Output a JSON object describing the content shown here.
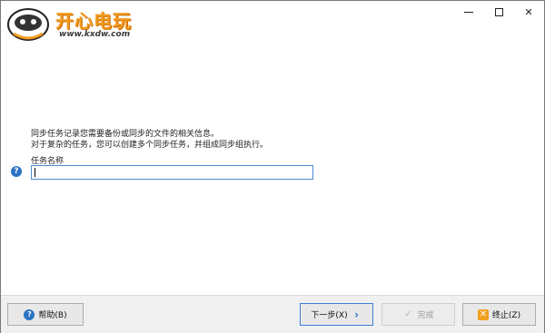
{
  "watermark": {
    "title": "开心电玩",
    "url": "www.kxdw.com"
  },
  "window_controls": {
    "minimize": "—",
    "maximize": "□",
    "close": "✕"
  },
  "content": {
    "description_line1": "同步任务记录您需要备份或同步的文件的相关信息。",
    "description_line2": "对于复杂的任务，您可以创建多个同步任务，并组成同步组执行。",
    "task_name_label": "任务名称",
    "task_name_value": "",
    "task_name_placeholder": ""
  },
  "footer": {
    "help_label": "帮助(B)",
    "next_label": "下一步(X)",
    "finish_label": "完成",
    "stop_label": "终止(Z)"
  },
  "colors": {
    "accent": "#2b73c4",
    "logo": "#f29a1f",
    "stop_icon": "#f1a020"
  }
}
